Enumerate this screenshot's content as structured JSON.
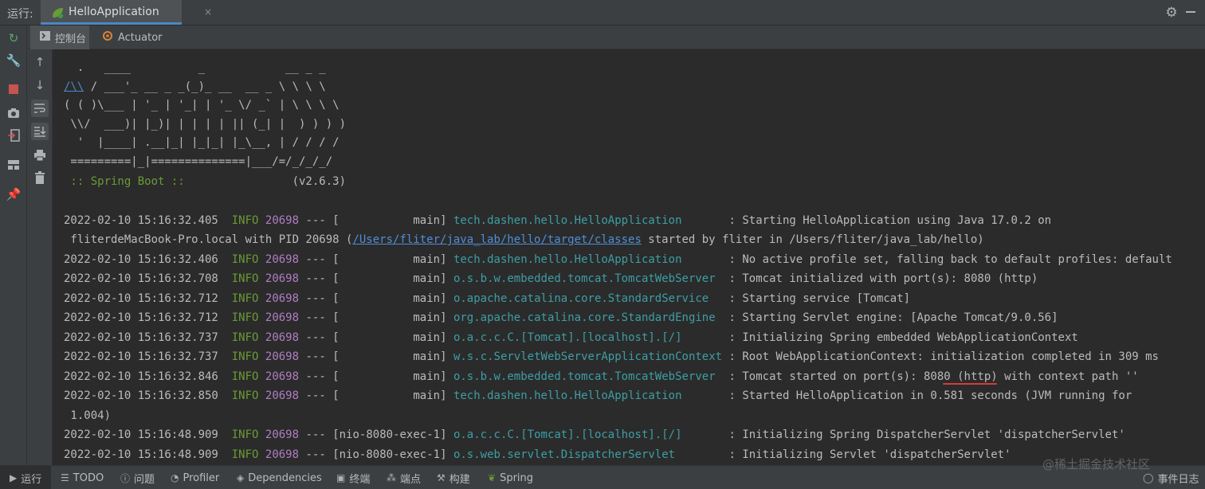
{
  "topbar": {
    "run_label": "运行:",
    "tab_title": "HelloApplication",
    "close": "×"
  },
  "subtabs": {
    "console_label": "控制台",
    "actuator_label": "Actuator"
  },
  "banner": [
    "  .   ____          _            __ _ _",
    " /\\\\ / ___'_ __ _ _(_)_ __  __ _ \\ \\ \\ \\",
    "( ( )\\___ | '_ | '_| | '_ \\/ _` | \\ \\ \\ \\",
    " \\\\/  ___)| |_)| | | | | || (_| |  ) ) ) )",
    "  '  |____| .__|_| |_|_| |_\\__, | / / / /",
    " =========|_|==============|___/=/_/_/_/",
    " :: Spring Boot ::",
    "                (v2.6.3)"
  ],
  "banner_slash": "/\\\\",
  "banner_rest": " / ___'_ __ _ _(_)_ __  __ _ \\ \\ \\ \\",
  "logs": [
    {
      "ts": "2022-02-10 15:16:32.405",
      "level": "INFO",
      "pid": "20698",
      "sep": "--- [",
      "thread": "           main]",
      "logger": "tech.dashen.hello.HelloApplication      ",
      "msg": " : Starting HelloApplication using Java 17.0.2 on"
    },
    {
      "ts": "2022-02-10 15:16:32.406",
      "level": "INFO",
      "pid": "20698",
      "sep": "--- [",
      "thread": "           main]",
      "logger": "tech.dashen.hello.HelloApplication      ",
      "msg": " : No active profile set, falling back to default profiles: default"
    },
    {
      "ts": "2022-02-10 15:16:32.708",
      "level": "INFO",
      "pid": "20698",
      "sep": "--- [",
      "thread": "           main]",
      "logger": "o.s.b.w.embedded.tomcat.TomcatWebServer ",
      "msg": " : Tomcat initialized with port(s): 8080 (http)"
    },
    {
      "ts": "2022-02-10 15:16:32.712",
      "level": "INFO",
      "pid": "20698",
      "sep": "--- [",
      "thread": "           main]",
      "logger": "o.apache.catalina.core.StandardService  ",
      "msg": " : Starting service [Tomcat]"
    },
    {
      "ts": "2022-02-10 15:16:32.712",
      "level": "INFO",
      "pid": "20698",
      "sep": "--- [",
      "thread": "           main]",
      "logger": "org.apache.catalina.core.StandardEngine ",
      "msg": " : Starting Servlet engine: [Apache Tomcat/9.0.56]"
    },
    {
      "ts": "2022-02-10 15:16:32.737",
      "level": "INFO",
      "pid": "20698",
      "sep": "--- [",
      "thread": "           main]",
      "logger": "o.a.c.c.C.[Tomcat].[localhost].[/]      ",
      "msg": " : Initializing Spring embedded WebApplicationContext"
    },
    {
      "ts": "2022-02-10 15:16:32.737",
      "level": "INFO",
      "pid": "20698",
      "sep": "--- [",
      "thread": "           main]",
      "logger": "w.s.c.ServletWebServerApplicationContext",
      "msg": " : Root WebApplicationContext: initialization completed in 309 ms"
    },
    {
      "ts": "2022-02-10 15:16:32.846",
      "level": "INFO",
      "pid": "20698",
      "sep": "--- [",
      "thread": "           main]",
      "logger": "o.s.b.w.embedded.tomcat.TomcatWebServer ",
      "msg": " : Tomcat started on port(s): 8080 (http) with context path ''"
    },
    {
      "ts": "2022-02-10 15:16:32.850",
      "level": "INFO",
      "pid": "20698",
      "sep": "--- [",
      "thread": "           main]",
      "logger": "tech.dashen.hello.HelloApplication      ",
      "msg": " : Started HelloApplication in 0.581 seconds (JVM running for"
    },
    {
      "ts": "2022-02-10 15:16:48.909",
      "level": "INFO",
      "pid": "20698",
      "sep": "--- [",
      "thread": "nio-8080-exec-1]",
      "logger": "o.a.c.c.C.[Tomcat].[localhost].[/]      ",
      "msg": " : Initializing Spring DispatcherServlet 'dispatcherServlet'"
    },
    {
      "ts": "2022-02-10 15:16:48.909",
      "level": "INFO",
      "pid": "20698",
      "sep": "--- [",
      "thread": "nio-8080-exec-1]",
      "logger": "o.s.web.servlet.DispatcherServlet       ",
      "msg": " : Initializing Servlet 'dispatcherServlet'"
    }
  ],
  "wrap1_pre": " fliterdeMacBook-Pro.local with PID 20698 (",
  "wrap1_link": "/Users/fliter/java_lab/hello/target/classes",
  "wrap1_post": " started by fliter in /Users/fliter/java_lab/hello)",
  "wrap2": " 1.004)",
  "bottombar": {
    "run": "运行",
    "todo": "TODO",
    "problems": "问题",
    "profiler": "Profiler",
    "dependencies": "Dependencies",
    "terminal": "终端",
    "endpoints": "端点",
    "build": "构建",
    "spring": "Spring",
    "event_log": "事件日志"
  },
  "watermark": "@稀土掘金技术社区",
  "colors": {
    "accent": "#4a88c7",
    "info": "#6a9b35",
    "pid": "#b07dc2",
    "logger": "#3d9ea5",
    "highlight": "#d83b3b"
  }
}
